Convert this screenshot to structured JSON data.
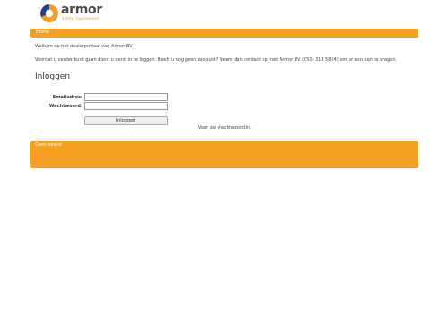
{
  "brand": {
    "name": "armor",
    "tagline": "safety. Guaranteed.",
    "colors": {
      "orange": "#f6a021",
      "logo_blue": "#1f3f8a",
      "text_gray": "#4a4a4a"
    }
  },
  "nav": {
    "home_label": "Home"
  },
  "intro": {
    "welcome": "Welkom op het dealerportaal van Armor BV.",
    "instructions": "Voordat u verder kunt gaan dient u eerst in te loggen. Heeft u nog geen account? Neem dan contact op met Armor BV (050- 316 5824) om er een aan te vragen."
  },
  "login": {
    "title": "Inloggen",
    "email_label": "Emailadres:",
    "email_value": "",
    "password_label": "Wachtwoord:",
    "password_value": "",
    "submit_label": "Inloggen",
    "message": "Voer uw wachtwoord in."
  },
  "footer": {
    "status": "Geen sessie"
  }
}
